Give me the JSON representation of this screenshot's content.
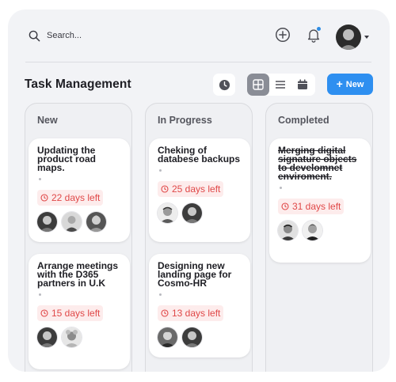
{
  "search": {
    "placeholder": "Search..."
  },
  "icons": {
    "search": "search-icon",
    "add": "plus-circle-icon",
    "notifications": "bell-icon",
    "profile_menu": "chevron-down-icon",
    "history": "clock-icon",
    "grid_view": "grid-icon",
    "list_view": "list-icon",
    "calendar_view": "calendar-icon",
    "due": "clock-icon"
  },
  "colors": {
    "accent": "#2e8ff0",
    "due_text": "#e04848",
    "due_bg": "#fdecec",
    "active_view": "#8a8d96"
  },
  "page": {
    "title": "Task Management",
    "new_button": "New",
    "active_view": "grid"
  },
  "columns": [
    {
      "title": "New",
      "cards": [
        {
          "title": "Updating the product road maps.",
          "due": "22 days left",
          "completed": false,
          "assignees": 3
        },
        {
          "title": "Arrange meetings with the D365 partners in U.K",
          "due": "15 days left",
          "completed": false,
          "assignees": 2
        }
      ]
    },
    {
      "title": "In Progress",
      "cards": [
        {
          "title": "Cheking of databese backups",
          "due": "25 days left",
          "completed": false,
          "assignees": 2
        },
        {
          "title": "Designing new landing page for Cosmo-HR",
          "due": "13 days left",
          "completed": false,
          "assignees": 2
        }
      ]
    },
    {
      "title": "Completed",
      "cards": [
        {
          "title": "Merging digital signature objects to develomnet enviroment.",
          "due": "31 days left",
          "completed": true,
          "assignees": 2
        }
      ]
    }
  ]
}
